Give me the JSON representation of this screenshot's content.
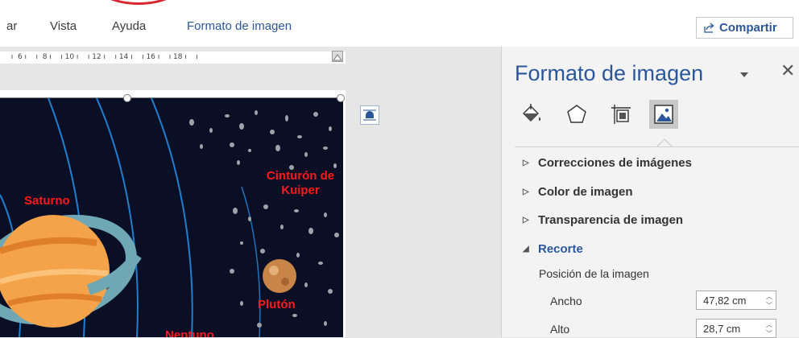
{
  "ribbon": {
    "tabs": [
      {
        "label": "ar",
        "active": false
      },
      {
        "label": "Vista",
        "active": false
      },
      {
        "label": "Ayuda",
        "active": false
      },
      {
        "label": "Formato de imagen",
        "active": true
      }
    ],
    "share_label": "Compartir",
    "share_icon": "share-icon",
    "accent_color": "#2b579a"
  },
  "ruler": {
    "ticks": "  ı  6 ı    ı  8 ı    ı 10 ı    ı 12 ı    ı 14 ı    ı 16 ı    ı 18 ı    ı"
  },
  "image": {
    "labels": {
      "saturno": "Saturno",
      "cinturon": "Cinturón de\nKuiper",
      "pluton": "Plutón",
      "neptuno": "Neptuno"
    },
    "label_color": "#ff1a1a",
    "background_color": "#0b0f26"
  },
  "pane": {
    "title": "Formato de imagen",
    "icons": [
      "fill-line-icon",
      "effects-icon",
      "layout-properties-icon",
      "picture-icon"
    ],
    "selected_icon": "picture-icon",
    "sections": [
      {
        "label": "Correcciones de imágenes",
        "expanded": false
      },
      {
        "label": "Color de imagen",
        "expanded": false
      },
      {
        "label": "Transparencia de imagen",
        "expanded": false
      },
      {
        "label": "Recorte",
        "expanded": true
      }
    ],
    "crop": {
      "picture_position_label": "Posición de la imagen",
      "width_label": "Ancho",
      "width_value": "47,82 cm",
      "height_label": "Alto",
      "height_value": "28,7 cm"
    }
  }
}
